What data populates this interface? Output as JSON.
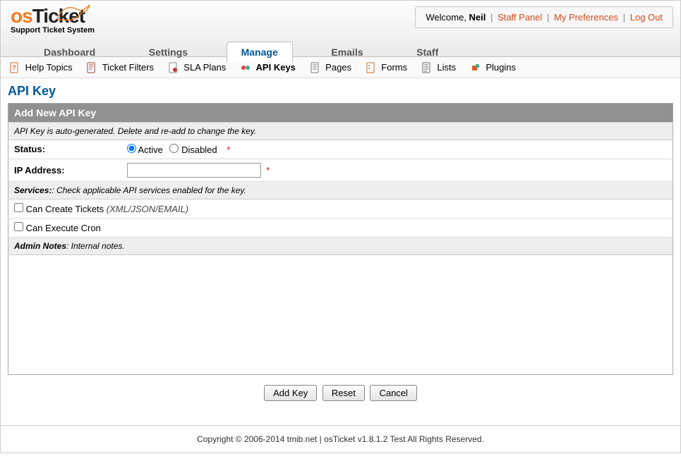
{
  "logo": {
    "prefix": "os",
    "suffix": "Ticket",
    "subtitle": "Support Ticket System"
  },
  "user": {
    "welcome": "Welcome, ",
    "name": "Neil",
    "links": {
      "staff": "Staff Panel",
      "prefs": "My Preferences",
      "logout": "Log Out"
    }
  },
  "mainnav": [
    {
      "label": "Dashboard",
      "active": false
    },
    {
      "label": "Settings",
      "active": false
    },
    {
      "label": "Manage",
      "active": true
    },
    {
      "label": "Emails",
      "active": false
    },
    {
      "label": "Staff",
      "active": false
    }
  ],
  "subnav": [
    {
      "label": "Help Topics",
      "icon": "help",
      "active": false
    },
    {
      "label": "Ticket Filters",
      "icon": "filter",
      "active": false
    },
    {
      "label": "SLA Plans",
      "icon": "sla",
      "active": false
    },
    {
      "label": "API Keys",
      "icon": "api",
      "active": true
    },
    {
      "label": "Pages",
      "icon": "pages",
      "active": false
    },
    {
      "label": "Forms",
      "icon": "forms",
      "active": false
    },
    {
      "label": "Lists",
      "icon": "lists",
      "active": false
    },
    {
      "label": "Plugins",
      "icon": "plugins",
      "active": false
    }
  ],
  "page": {
    "title": "API Key",
    "section": "Add New API Key",
    "hint": "API Key is auto-generated. Delete and re-add to change the key.",
    "status_label": "Status:",
    "status_active": "Active",
    "status_disabled": "Disabled",
    "ip_label": "IP Address:",
    "ip_value": "",
    "services_hdr_prefix": "Services:",
    "services_hdr_rest": ": Check applicable API services enabled for the key.",
    "service_create_label": "Can Create Tickets",
    "service_create_hint": "(XML/JSON/EMAIL)",
    "service_cron_label": "Can Execute Cron",
    "notes_hdr_prefix": "Admin Notes",
    "notes_hdr_rest": ": Internal notes.",
    "buttons": {
      "add": "Add Key",
      "reset": "Reset",
      "cancel": "Cancel"
    }
  },
  "footer": "Copyright © 2006-2014 tmib.net | osTicket v1.8.1.2 Test All Rights Reserved."
}
